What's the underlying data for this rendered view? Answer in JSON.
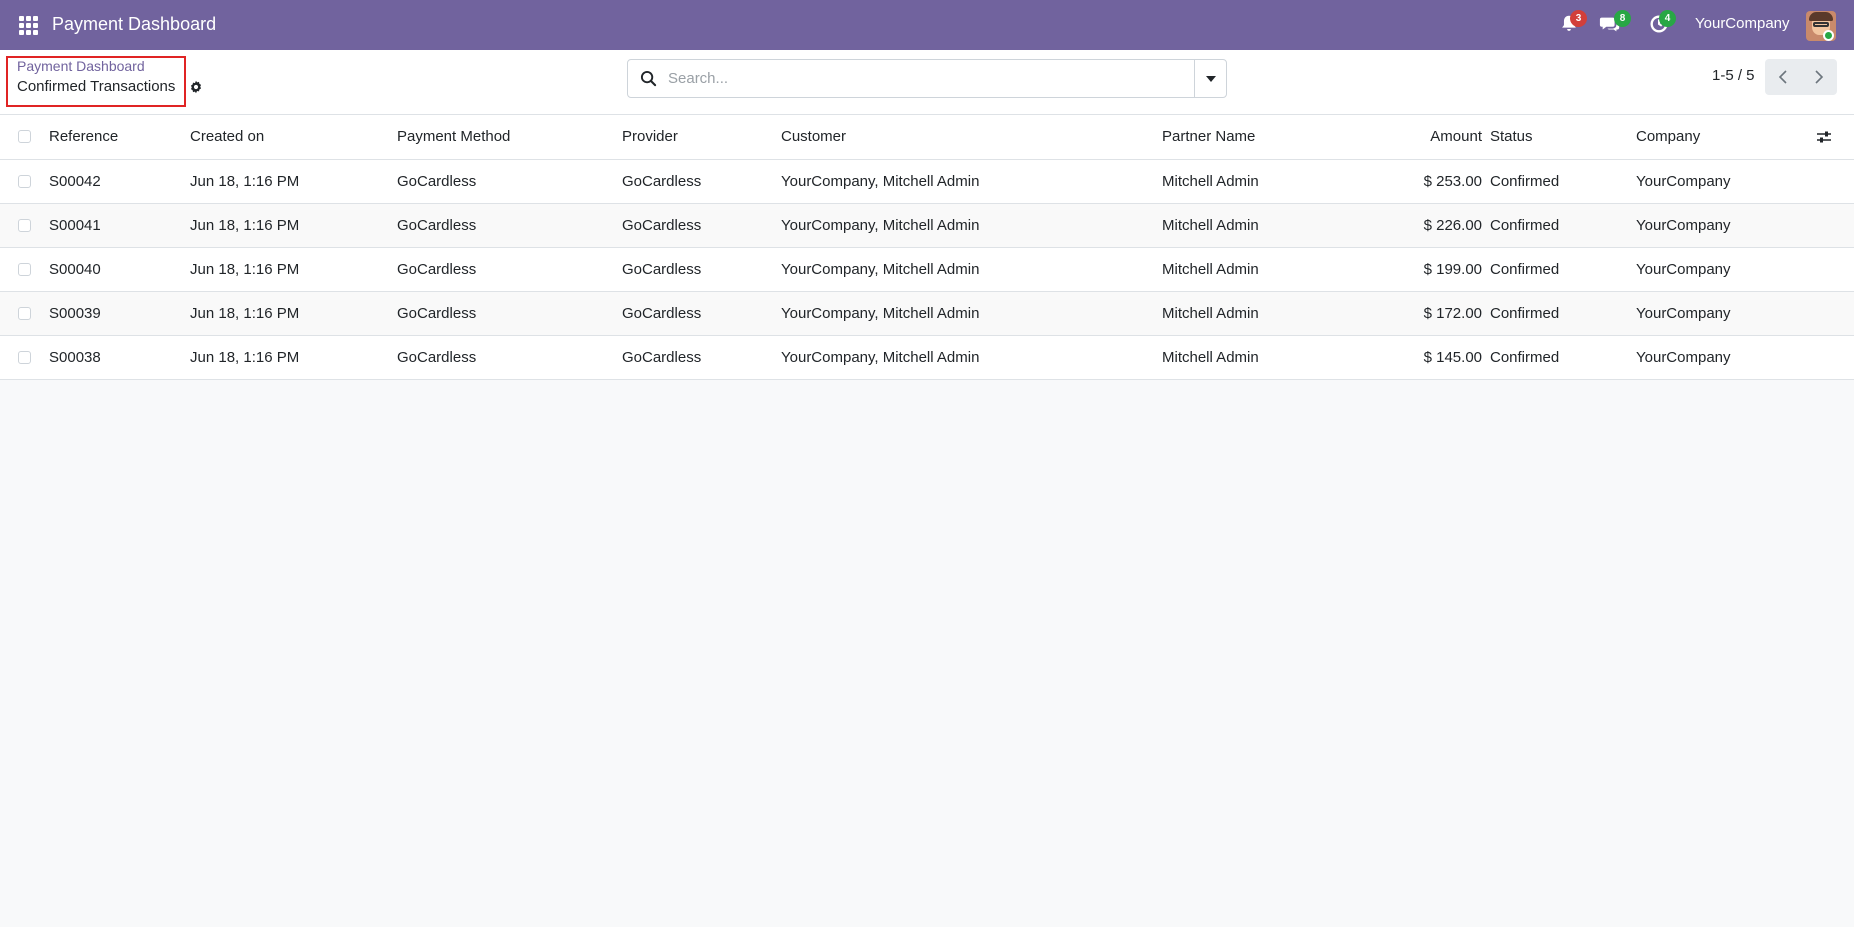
{
  "navbar": {
    "app_title": "Payment Dashboard",
    "activity_count": "3",
    "messages_count": "8",
    "clock_count": "4",
    "company_name": "YourCompany",
    "bg_color": "#71639e"
  },
  "breadcrumb": {
    "parent": "Payment Dashboard",
    "current": "Confirmed Transactions"
  },
  "search": {
    "placeholder": "Search..."
  },
  "pager": {
    "value": "1-5 / 5"
  },
  "table": {
    "headers": {
      "reference": "Reference",
      "created_on": "Created on",
      "payment_method": "Payment Method",
      "provider": "Provider",
      "customer": "Customer",
      "partner_name": "Partner Name",
      "amount": "Amount",
      "status": "Status",
      "company": "Company"
    },
    "rows": [
      {
        "reference": "S00042",
        "created_on": "Jun 18, 1:16 PM",
        "payment_method": "GoCardless",
        "provider": "GoCardless",
        "customer": "YourCompany, Mitchell Admin",
        "partner_name": "Mitchell Admin",
        "amount": "$ 253.00",
        "status": "Confirmed",
        "company": "YourCompany"
      },
      {
        "reference": "S00041",
        "created_on": "Jun 18, 1:16 PM",
        "payment_method": "GoCardless",
        "provider": "GoCardless",
        "customer": "YourCompany, Mitchell Admin",
        "partner_name": "Mitchell Admin",
        "amount": "$ 226.00",
        "status": "Confirmed",
        "company": "YourCompany"
      },
      {
        "reference": "S00040",
        "created_on": "Jun 18, 1:16 PM",
        "payment_method": "GoCardless",
        "provider": "GoCardless",
        "customer": "YourCompany, Mitchell Admin",
        "partner_name": "Mitchell Admin",
        "amount": "$ 199.00",
        "status": "Confirmed",
        "company": "YourCompany"
      },
      {
        "reference": "S00039",
        "created_on": "Jun 18, 1:16 PM",
        "payment_method": "GoCardless",
        "provider": "GoCardless",
        "customer": "YourCompany, Mitchell Admin",
        "partner_name": "Mitchell Admin",
        "amount": "$ 172.00",
        "status": "Confirmed",
        "company": "YourCompany"
      },
      {
        "reference": "S00038",
        "created_on": "Jun 18, 1:16 PM",
        "payment_method": "GoCardless",
        "provider": "GoCardless",
        "customer": "YourCompany, Mitchell Admin",
        "partner_name": "Mitchell Admin",
        "amount": "$ 145.00",
        "status": "Confirmed",
        "company": "YourCompany"
      }
    ]
  }
}
